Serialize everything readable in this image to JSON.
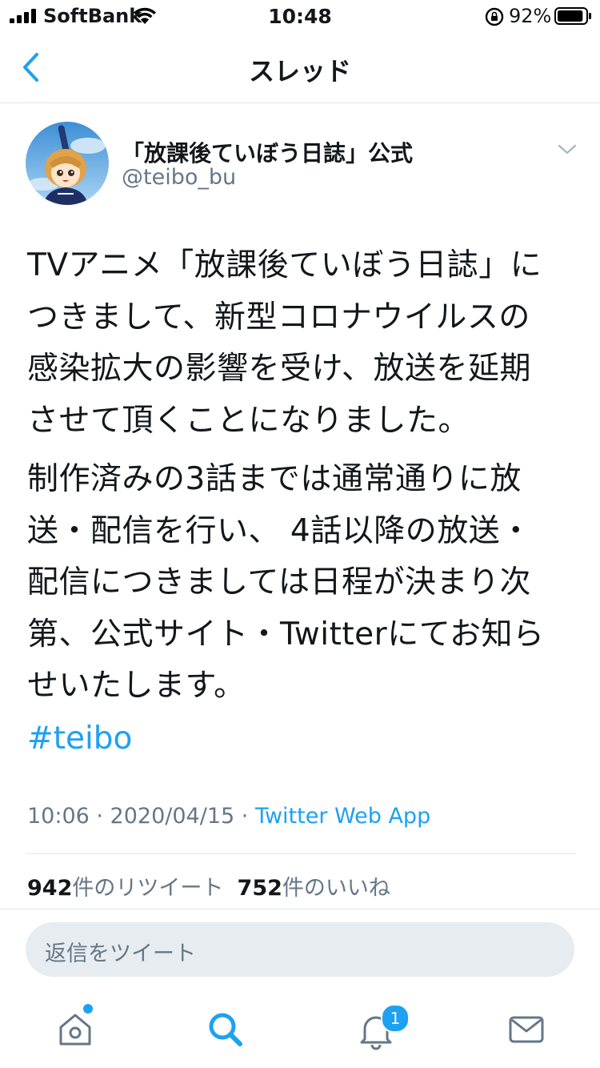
{
  "status_bar": {
    "carrier": "SoftBank",
    "time": "10:48",
    "battery_percent": "92%",
    "battery_level": 0.92
  },
  "nav": {
    "title": "スレッド"
  },
  "tweet": {
    "display_name": "「放課後ていぼう日誌」公式",
    "handle": "@teibo_bu",
    "paragraph1_lines": [
      "TVアニメ「放課後ていぼう日誌」に",
      "つきまして、新型コロナウイルスの",
      "感染拡大の影響を受け、放送を延期",
      "させて頂くことになりました。"
    ],
    "paragraph2_lines": [
      "制作済みの3話までは通常通りに放",
      "送・配信を行い、 4話以降の放送・",
      "配信につきましては日程が決まり次",
      "第、公式サイト・Twitterにてお知ら",
      "せいたします。"
    ],
    "hashtag": "#teibo",
    "timestamp": "10:06 · 2020/04/15 · ",
    "source": "Twitter Web App",
    "retweet_count": "942",
    "retweet_label": "件のリツイート",
    "like_count": "752",
    "like_label": "件のいいね"
  },
  "reply": {
    "placeholder": "返信をツイート"
  },
  "tab_bar": {
    "notification_badge": "1"
  },
  "colors": {
    "accent": "#1da1f2",
    "secondary_text": "#657786",
    "divider": "#e1e8ed",
    "reply_bg": "#e6ecf0"
  },
  "icons": [
    "signal-icon",
    "wifi-icon",
    "rotation-lock-icon",
    "battery-icon",
    "back-chevron-icon",
    "caret-down-icon",
    "home-icon",
    "search-icon",
    "bell-icon",
    "mail-icon"
  ]
}
